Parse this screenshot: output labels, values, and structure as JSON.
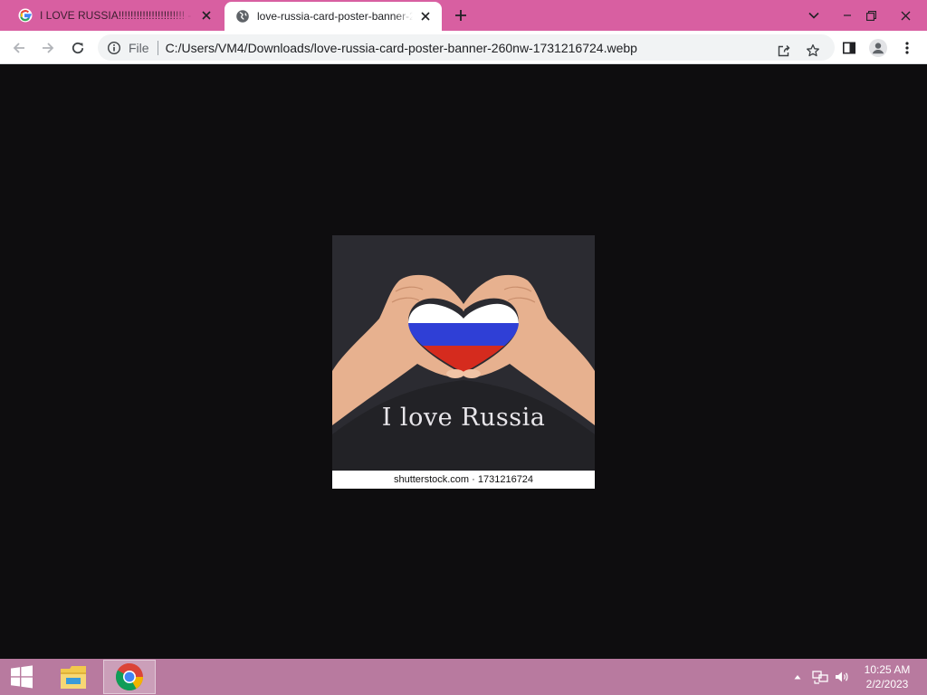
{
  "browser": {
    "tabs": [
      {
        "title": "I LOVE RUSSIA!!!!!!!!!!!!!!!!!!!!!! - G",
        "favicon": "google-icon",
        "active": false
      },
      {
        "title": "love-russia-card-poster-banner-2",
        "favicon": "globe-icon",
        "active": true
      }
    ],
    "address_bar": {
      "scheme_label": "File",
      "url": "C:/Users/VM4/Downloads/love-russia-card-poster-banner-260nw-1731216724.webp"
    },
    "colors": {
      "tabstrip": "#d85fa1",
      "viewer_background": "#0e0d0f"
    }
  },
  "image": {
    "art_text": "I love Russia",
    "caption": "shutterstock.com · 1731216724",
    "flag_colors": [
      "#ffffff",
      "#2f3fd6",
      "#d52b1e"
    ]
  },
  "taskbar": {
    "pinned": [
      "file-explorer-icon",
      "chrome-icon"
    ],
    "tray_icons": [
      "show-hidden-icons-icon",
      "network-icon",
      "volume-icon"
    ],
    "time": "10:25 AM",
    "date": "2/2/2023",
    "color": "#b87a9f"
  }
}
